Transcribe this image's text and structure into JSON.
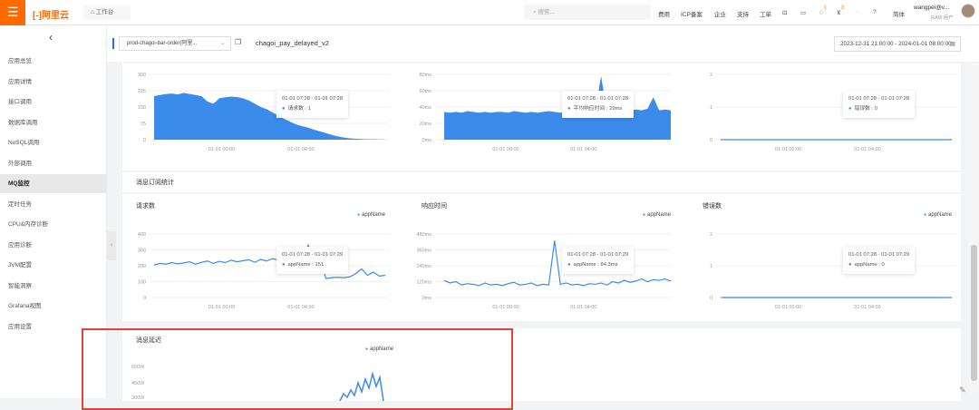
{
  "topbar": {
    "logo": "[-]阿里云",
    "workspace": "工作台",
    "search_placeholder": "搜索...",
    "nav": [
      "费用",
      "ICP备案",
      "企业",
      "支持",
      "工单"
    ],
    "bell_badge": "1",
    "cart_badge": "3",
    "lang": "简体",
    "user": "wangpei@v...",
    "user_role": "RAM 用户"
  },
  "sidebar": {
    "items": [
      "应用总览",
      "应用详情",
      "接口调用",
      "数据库调用",
      "NoSQL调用",
      "外部调用",
      "MQ监控",
      "定时任务",
      "CPU&内存诊断",
      "应用诊断",
      "JVM配置",
      "智能洞察",
      "Grafana视图",
      "应用设置"
    ],
    "selected": "MQ监控"
  },
  "toolbar": {
    "app_select": "prod-chagoi-bar-order(阿里...",
    "topic": "chagoi_pay_delayed_v2",
    "date_range": "2023-12-31 21:00:00 - 2024-01-01 08:00:00"
  },
  "section_sub": "消息订阅统计",
  "section_delay": "消息延迟",
  "accent": "#3b8beb",
  "charts": [
    {
      "type": "area",
      "yticks": [
        "0",
        "75",
        "150",
        "225",
        "300"
      ],
      "ymax": 300,
      "xticks": [
        "01-01 00:00",
        "01-01 04:00"
      ],
      "values": [
        200,
        205,
        210,
        212,
        208,
        215,
        210,
        205,
        200,
        175,
        165,
        190,
        195,
        198,
        196,
        190,
        180,
        165,
        150,
        140,
        125,
        110,
        95,
        82,
        70,
        62,
        55,
        46,
        38,
        30,
        22,
        15,
        10,
        6,
        4,
        3,
        2,
        2,
        1,
        1
      ],
      "tip": {
        "time": "01-01 07:28 - 01-01 07:28",
        "name": "请求数",
        "value": "1"
      }
    },
    {
      "type": "area",
      "yticks": [
        "0ms",
        "20ms",
        "40ms",
        "60ms",
        "80ms"
      ],
      "ymax": 80,
      "xticks": [
        "01-01 00:00",
        "01-01 04:00"
      ],
      "values": [
        34,
        33,
        34,
        33,
        35,
        34,
        33,
        34,
        33,
        34,
        34,
        33,
        35,
        34,
        33,
        34,
        33,
        34,
        35,
        34,
        33,
        34,
        35,
        34,
        35,
        36,
        35,
        78,
        34,
        35,
        36,
        35,
        36,
        37,
        36,
        38,
        52,
        36,
        37,
        36
      ],
      "tip": {
        "time": "01-01 07:28 - 01-01 07:28",
        "name": "平均响应时间",
        "value": "29ms"
      }
    },
    {
      "type": "line",
      "yticks": [
        "0",
        "1",
        "2"
      ],
      "ymax": 2,
      "xticks": [
        "01-01 00:00",
        "01-01 04:00"
      ],
      "values": [
        0,
        0,
        0,
        0,
        0,
        0,
        0,
        0,
        0,
        0,
        0,
        0,
        0,
        0,
        0,
        0,
        0,
        0,
        0,
        0,
        0,
        0,
        0,
        0,
        0,
        0,
        0,
        0,
        0,
        0,
        0,
        0,
        0,
        0,
        0,
        0,
        0,
        0,
        0,
        0
      ],
      "tip": {
        "time": "01-01 07:28 - 01-01 07:28",
        "name": "错误数",
        "value": "0"
      }
    },
    {
      "title": "请求数",
      "legend": "appName",
      "type": "line",
      "yticks": [
        "0",
        "100",
        "200",
        "300",
        "400"
      ],
      "ymax": 400,
      "xticks": [
        "01-01 00:00",
        "01-01 04:00"
      ],
      "values": [
        205,
        215,
        210,
        220,
        212,
        218,
        225,
        210,
        222,
        230,
        215,
        228,
        220,
        235,
        225,
        232,
        238,
        222,
        240,
        230,
        245,
        235,
        260,
        240,
        230,
        225,
        330,
        240,
        235,
        120,
        125,
        128,
        125,
        130,
        150,
        180,
        140,
        160,
        135,
        140
      ],
      "tip": {
        "time": "01-01 07:28 - 01-01 07:29",
        "name": "appName",
        "value": "151"
      }
    },
    {
      "title": "响应时间",
      "legend": "appName",
      "type": "line",
      "yticks": [
        "0ms",
        "120ms",
        "240ms",
        "360ms",
        "480ms"
      ],
      "ymax": 480,
      "xticks": [
        "01-01 00:00",
        "01-01 04:00"
      ],
      "values": [
        130,
        110,
        120,
        95,
        105,
        100,
        90,
        110,
        95,
        100,
        90,
        105,
        115,
        95,
        100,
        110,
        90,
        100,
        95,
        430,
        100,
        110,
        95,
        100,
        90,
        105,
        100,
        110,
        95,
        120,
        110,
        130,
        115,
        125,
        140,
        120,
        135,
        130,
        140,
        125
      ],
      "tip": {
        "time": "01-01 07:28 - 01-01 07:29",
        "name": "appName",
        "value": "84.3ms"
      }
    },
    {
      "title": "错误数",
      "legend": "appName",
      "type": "line",
      "yticks": [
        "0",
        "1",
        "2"
      ],
      "ymax": 2,
      "xticks": [
        "01-01 00:00",
        "01-01 04:00"
      ],
      "values": [
        0,
        0,
        0,
        0,
        0,
        0,
        0,
        0,
        0,
        0,
        0,
        0,
        0,
        0,
        0,
        0,
        0,
        0,
        0,
        0,
        0,
        0,
        0,
        0,
        0,
        0,
        0,
        0,
        0,
        0,
        0,
        0,
        0,
        0,
        0,
        0,
        0,
        0,
        0,
        0
      ],
      "tip": {
        "time": "01-01 07:28 - 01-01 07:29",
        "name": "appName",
        "value": "0"
      }
    }
  ],
  "delay_chart": {
    "legend": "appName",
    "yticks": [
      "600W",
      "450W",
      "300W"
    ]
  }
}
